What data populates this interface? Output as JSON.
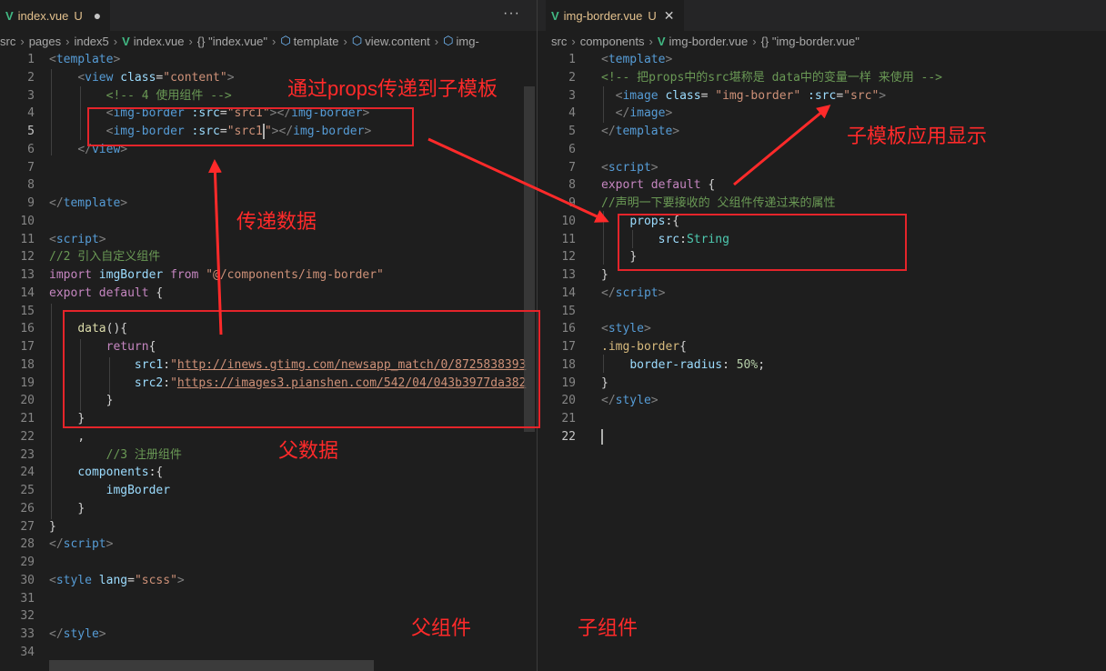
{
  "left_pane": {
    "tab": {
      "icon": "vue-icon",
      "file": "index.vue",
      "status": "U",
      "dirty_glyph": "●"
    },
    "more_glyph": "···",
    "breadcrumb": {
      "parts": [
        "src",
        "pages",
        "index5",
        "index.vue",
        "{} \"index.vue\"",
        "template",
        "view.content",
        "img-"
      ],
      "sep": "›"
    },
    "line_numbers": [
      "1",
      "2",
      "3",
      "4",
      "5",
      "6",
      "7",
      "8",
      "9",
      "10",
      "11",
      "12",
      "13",
      "14",
      "15",
      "16",
      "17",
      "18",
      "19",
      "20",
      "21",
      "22",
      "23",
      "24",
      "25",
      "26",
      "27",
      "28",
      "29",
      "30",
      "31",
      "32",
      "33",
      "34"
    ],
    "active_line": "5",
    "code": {
      "l1": {
        "indent": "",
        "open": "<",
        "tag": "template",
        "close": ">"
      },
      "l2": {
        "indent": "    ",
        "open": "<",
        "tag": "view",
        "attr": " class",
        "eq": "=",
        "val": "\"content\"",
        "close": ">"
      },
      "l3": {
        "indent": "        ",
        "text": "<!-- 4 使用组件 -->"
      },
      "l4": {
        "indent": "        ",
        "open": "<",
        "tag": "img-border",
        "attr": " :src",
        "eq": "=",
        "val": "\"src1\"",
        "close": "></",
        "tag2": "img-border",
        "close2": ">"
      },
      "l5": {
        "indent": "        ",
        "open": "<",
        "tag": "img-border",
        "attr": " :src",
        "eq": "=",
        "val_a": "\"src1",
        "val_b": "\"",
        "close": "></",
        "tag2": "img-border",
        "close2": ">"
      },
      "l6": {
        "indent": "    ",
        "open": "</",
        "tag": "view",
        "close": ">"
      },
      "l9": {
        "indent": "",
        "open": "</",
        "tag": "template",
        "close": ">"
      },
      "l11": {
        "indent": "",
        "open": "<",
        "tag": "script",
        "close": ">"
      },
      "l12": {
        "indent": "",
        "text": "//2 引入自定义组件"
      },
      "l13": {
        "indent": "",
        "kw1": "import",
        "name": " imgBorder ",
        "kw2": "from",
        "sp": " ",
        "str": "\"@/components/img-border\""
      },
      "l14": {
        "indent": "",
        "kw1": "export",
        "kw2": " default",
        "punc": " {"
      },
      "l16": {
        "indent": "    ",
        "fn": "data",
        "punc": "(){"
      },
      "l17": {
        "indent": "        ",
        "kw": "return",
        "punc": "{"
      },
      "l18": {
        "indent": "            ",
        "key": "src1",
        "colon": ":",
        "q": "\"",
        "url": "http://inews.gtimg.com/newsapp_match/0/8725838393"
      },
      "l19": {
        "indent": "            ",
        "key": "src2",
        "colon": ":",
        "q": "\"",
        "url": "https://images3.pianshen.com/542/04/043b3977da382"
      },
      "l20": {
        "indent": "        ",
        "punc": "}"
      },
      "l21": {
        "indent": "    ",
        "punc": "}"
      },
      "l22": {
        "indent": "    ",
        "punc": ","
      },
      "l23": {
        "indent": "        ",
        "text": "//3 注册组件"
      },
      "l24": {
        "indent": "    ",
        "key": "components",
        "punc": ":{"
      },
      "l25": {
        "indent": "        ",
        "text": "imgBorder"
      },
      "l26": {
        "indent": "    ",
        "punc": "}"
      },
      "l27": {
        "indent": "",
        "punc": "}"
      },
      "l28": {
        "indent": "",
        "open": "</",
        "tag": "script",
        "close": ">"
      },
      "l30": {
        "indent": "",
        "open": "<",
        "tag": "style",
        "attr": " lang",
        "eq": "=",
        "val": "\"scss\"",
        "close": ">"
      },
      "l33": {
        "indent": "",
        "open": "</",
        "tag": "style",
        "close": ">"
      }
    }
  },
  "right_pane": {
    "tab": {
      "icon": "vue-icon",
      "file": "img-border.vue",
      "status": "U",
      "close_glyph": "✕"
    },
    "breadcrumb": {
      "parts": [
        "src",
        "components",
        "img-border.vue",
        "{} \"img-border.vue\""
      ],
      "sep": "›"
    },
    "line_numbers": [
      "1",
      "2",
      "3",
      "4",
      "5",
      "6",
      "7",
      "8",
      "9",
      "10",
      "11",
      "12",
      "13",
      "14",
      "15",
      "16",
      "17",
      "18",
      "19",
      "20",
      "21",
      "22"
    ],
    "active_line": "22",
    "code": {
      "l1": {
        "indent": "",
        "open": "<",
        "tag": "template",
        "close": ">"
      },
      "l2": {
        "indent": "",
        "text": "<!-- 把props中的src堪称是 data中的变量一样 来使用 -->"
      },
      "l3": {
        "indent": "  ",
        "open": "<",
        "tag": "image",
        "attr": " class",
        "eq": "= ",
        "val": "\"img-border\"",
        "attr2": " :src",
        "eq2": "=",
        "val2": "\"src\"",
        "close": ">"
      },
      "l4": {
        "indent": "  ",
        "open": "</",
        "tag": "image",
        "close": ">"
      },
      "l5": {
        "indent": "",
        "open": "</",
        "tag": "template",
        "close": ">"
      },
      "l7": {
        "indent": "",
        "open": "<",
        "tag": "script",
        "close": ">"
      },
      "l8": {
        "indent": "",
        "kw1": "export",
        "kw2": " default",
        "punc": " {"
      },
      "l9": {
        "indent": "",
        "text": "//声明一下要接收的 父组件传递过来的属性"
      },
      "l10": {
        "indent": "    ",
        "key": "props",
        "punc": ":{"
      },
      "l11": {
        "indent": "        ",
        "key": "src",
        "colon": ":",
        "type": "String"
      },
      "l12": {
        "indent": "    ",
        "punc": "}"
      },
      "l13": {
        "indent": "",
        "punc": "}"
      },
      "l14": {
        "indent": "",
        "open": "</",
        "tag": "script",
        "close": ">"
      },
      "l16": {
        "indent": "",
        "open": "<",
        "tag": "style",
        "close": ">"
      },
      "l17": {
        "indent": "",
        "sel": ".img-border",
        "punc": "{"
      },
      "l18": {
        "indent": "    ",
        "prop": "border-radius",
        "colon": ": ",
        "num": "50%",
        "semi": ";"
      },
      "l19": {
        "indent": "",
        "punc": "}"
      },
      "l20": {
        "indent": "",
        "open": "</",
        "tag": "style",
        "close": ">"
      }
    }
  },
  "annotations": {
    "pass_props": "通过props传递到子模板",
    "pass_data": "传递数据",
    "parent_data": "父数据",
    "child_display": "子模板应用显示",
    "parent_component": "父组件",
    "child_component": "子组件"
  },
  "colors": {
    "annotation_red": "#ff2a2a",
    "vue_green": "#41b883",
    "untracked_yellow": "#e2c08d"
  }
}
